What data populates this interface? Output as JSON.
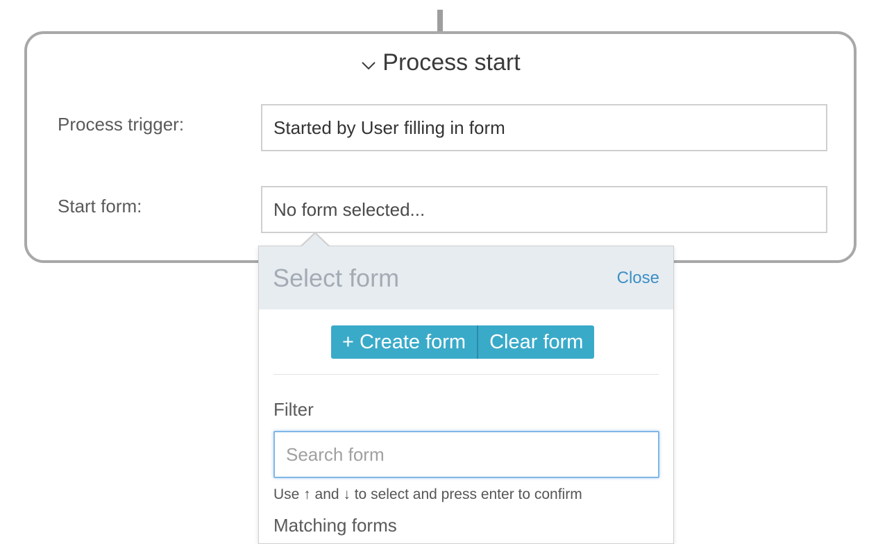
{
  "process": {
    "title": "Process start",
    "trigger_label": "Process trigger:",
    "trigger_value": "Started by User filling in form",
    "start_form_label": "Start form:",
    "start_form_value": "No form selected..."
  },
  "popover": {
    "title": "Select form",
    "close_label": "Close",
    "create_button": "+ Create form",
    "clear_button": "Clear form",
    "filter_label": "Filter",
    "search_placeholder": "Search form",
    "hint": "Use ↑ and ↓ to select and press enter to confirm",
    "matching_label": "Matching forms"
  },
  "colors": {
    "accent": "#3aaac9",
    "link": "#3d8fc6",
    "header_bg": "#e7ecf0"
  },
  "icons": {
    "title_toggle": "chevron-down-icon"
  }
}
